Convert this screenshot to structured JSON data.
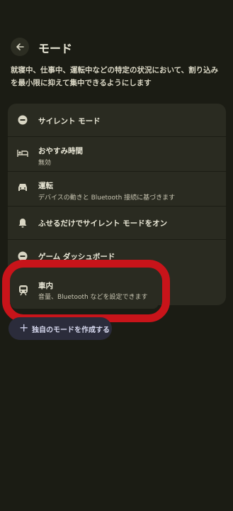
{
  "header": {
    "title": "モード",
    "back_icon": "back-arrow-icon"
  },
  "description": "就寝中、仕事中、運転中などの特定の状況において、割り込みを最小限に抑えて集中できるようにします",
  "modes": [
    {
      "title": "サイレント モード",
      "subtitle": "",
      "icon": "do-not-disturb-icon"
    },
    {
      "title": "おやすみ時間",
      "subtitle": "無効",
      "icon": "bed-icon"
    },
    {
      "title": "運転",
      "subtitle": "デバイスの動きと Bluetooth 接続に基づきます",
      "icon": "car-icon"
    },
    {
      "title": "ふせるだけでサイレント モードをオン",
      "subtitle": "",
      "icon": "flip-bell-icon"
    },
    {
      "title": "ゲーム ダッシュボード",
      "subtitle": "",
      "icon": "do-not-disturb-icon"
    },
    {
      "title": "車内",
      "subtitle": "音量、Bluetooth などを設定できます",
      "icon": "train-icon"
    }
  ],
  "create_button": {
    "label": "独自のモードを作成する",
    "icon": "plus-icon"
  },
  "colors": {
    "background": "#1b1c14",
    "card": "#2a2b21",
    "highlight": "#c8141a",
    "create_button": "#2b2c3b"
  }
}
